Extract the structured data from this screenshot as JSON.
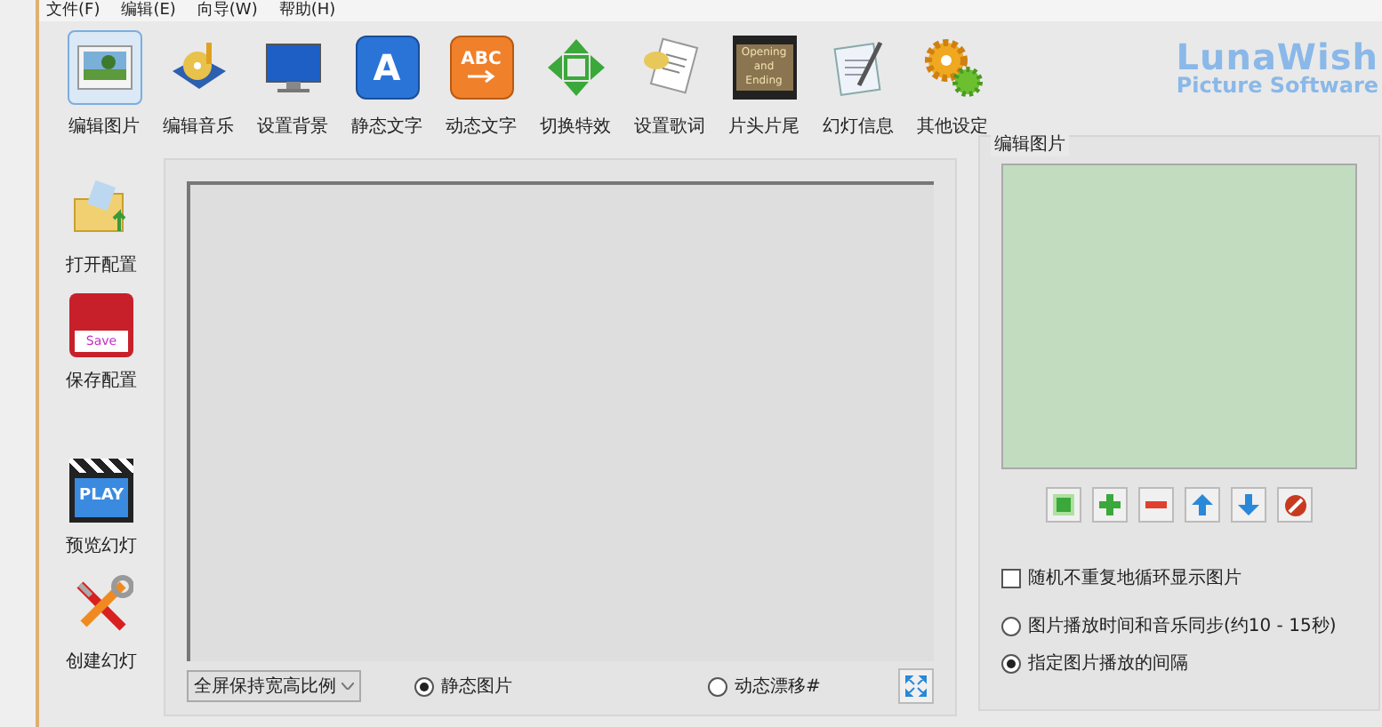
{
  "menu": [
    "文件(F)",
    "编辑(E)",
    "向导(W)",
    "帮助(H)"
  ],
  "toolbar": [
    {
      "kind": "photo",
      "label": "编辑图片",
      "selected": true
    },
    {
      "kind": "music",
      "label": "编辑音乐",
      "selected": false
    },
    {
      "kind": "monitor",
      "label": "设置背景",
      "selected": false
    },
    {
      "kind": "letter",
      "label": "静态文字",
      "icon_text": "A",
      "selected": false
    },
    {
      "kind": "abc",
      "label": "动态文字",
      "icon_text": "ABC",
      "selected": false
    },
    {
      "kind": "arrows",
      "label": "切换特效",
      "selected": false
    },
    {
      "kind": "lyrics",
      "label": "设置歌词",
      "selected": false
    },
    {
      "kind": "film",
      "label": "片头片尾",
      "icon_text": "Opening and Ending",
      "selected": false
    },
    {
      "kind": "notes",
      "label": "幻灯信息",
      "selected": false
    },
    {
      "kind": "gears",
      "label": "其他设定",
      "selected": false
    }
  ],
  "logo": {
    "line1": "LunaWish",
    "line2": "Picture Software"
  },
  "sidebar": [
    {
      "kind": "folder",
      "label": "打开配置"
    },
    {
      "kind": "save",
      "label": "保存配置",
      "icon_text": "Save"
    },
    {
      "kind": "play",
      "label": "预览幻灯",
      "icon_text": "PLAY"
    },
    {
      "kind": "tools",
      "label": "创建幻灯"
    }
  ],
  "preview": {
    "scale_mode": "全屏保持宽高比例",
    "modes": [
      {
        "label": "静态图片",
        "selected": true
      },
      {
        "label": "动态漂移#",
        "selected": false
      }
    ]
  },
  "image_panel": {
    "title": "编辑图片",
    "random_loop": {
      "label": "随机不重复地循环显示图片",
      "checked": false
    },
    "timing": [
      {
        "label": "图片播放时间和音乐同步(约10 - 15秒)",
        "selected": false
      },
      {
        "label": "指定图片播放的间隔",
        "selected": true
      }
    ]
  }
}
